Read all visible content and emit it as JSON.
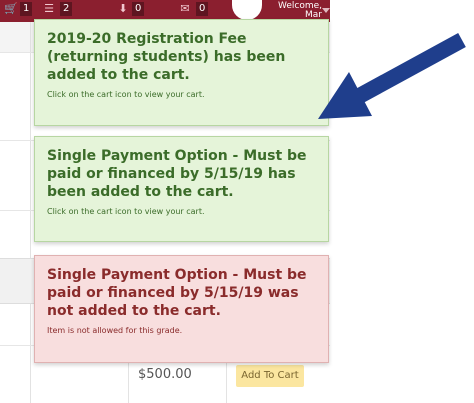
{
  "header": {
    "badge_cart": "1",
    "badge_list": "2",
    "badge_down": "0",
    "badge_mail": "0",
    "welcome_line1": "Welcome,",
    "welcome_line2": "Mar",
    "colors": {
      "bar": "#8b1f2f"
    }
  },
  "notifications": [
    {
      "status": "success",
      "title": "2019-20 Registration Fee (returning students) has been added to the cart.",
      "message": "Click on the cart icon to view your cart."
    },
    {
      "status": "success",
      "title": "Single Payment Option - Must be paid or financed by 5/15/19 has been added to the cart.",
      "message": "Click on the cart icon to view your cart."
    },
    {
      "status": "error",
      "title": "Single Payment Option - Must be paid or financed by 5/15/19 was not added to the cart.",
      "message": "Item is not allowed for this grade."
    }
  ],
  "background": {
    "price": "$500.00",
    "add_to_cart_label": "Add To Cart"
  },
  "annotation": {
    "arrow_color": "#1f3e8c"
  }
}
